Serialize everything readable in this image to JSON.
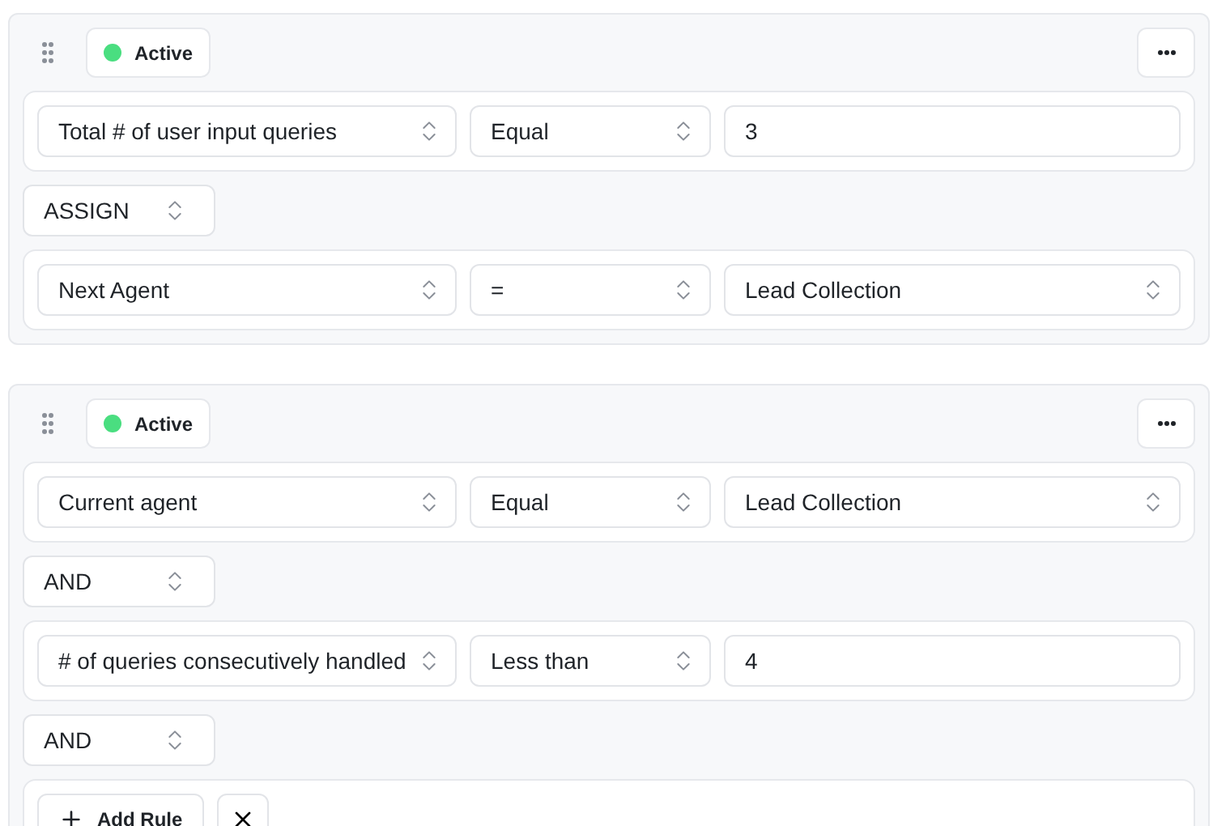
{
  "rules": [
    {
      "status": {
        "label": "Active",
        "color": "#4ade80"
      },
      "items": [
        {
          "kind": "condition",
          "fields": [
            {
              "kind": "select",
              "value": "Total # of user input queries"
            },
            {
              "kind": "select",
              "value": "Equal"
            },
            {
              "kind": "input",
              "value": "3"
            }
          ]
        },
        {
          "kind": "connector",
          "value": "ASSIGN"
        },
        {
          "kind": "condition",
          "fields": [
            {
              "kind": "select",
              "value": "Next Agent"
            },
            {
              "kind": "select",
              "value": "="
            },
            {
              "kind": "select",
              "value": "Lead Collection"
            }
          ]
        }
      ]
    },
    {
      "status": {
        "label": "Active",
        "color": "#4ade80"
      },
      "items": [
        {
          "kind": "condition",
          "fields": [
            {
              "kind": "select",
              "value": "Current agent"
            },
            {
              "kind": "select",
              "value": "Equal"
            },
            {
              "kind": "select",
              "value": "Lead Collection"
            }
          ]
        },
        {
          "kind": "connector",
          "value": "AND"
        },
        {
          "kind": "condition",
          "fields": [
            {
              "kind": "select",
              "value": "# of queries consecutively handled"
            },
            {
              "kind": "select",
              "value": "Less than"
            },
            {
              "kind": "input",
              "value": "4"
            }
          ]
        },
        {
          "kind": "connector",
          "value": "AND"
        },
        {
          "kind": "actions",
          "add_label": "Add Rule"
        }
      ]
    }
  ]
}
